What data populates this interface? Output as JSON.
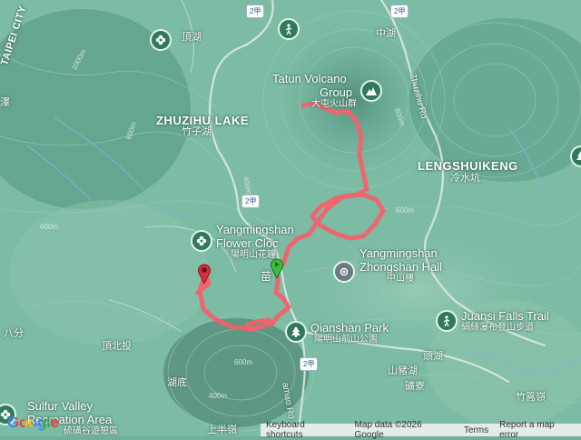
{
  "places": {
    "taipei_city": "TAIPEI CITY",
    "dinghu": "頂湖",
    "zhuzihu_en": "ZHUZIHU LAKE",
    "zhuzihu_zh": "竹子湖",
    "tatun_en_1": "Tatun Volcano",
    "tatun_en_2": "Group",
    "tatun_zh": "大屯火山群",
    "zhonghu": "中湖",
    "lengshuikeng_en": "LENGSHUIKENG",
    "lengshuikeng_zh": "冷水坑",
    "flower_clock_en_1": "Yangmingshan",
    "flower_clock_en_2": "Flower Cloc",
    "flower_clock_zh": "陽明山花鐘",
    "zhongshan_en_1": "Yangmingshan",
    "zhongshan_en_2": "Zhongshan Hall",
    "zhongshan_zh": "中山樓",
    "qianshan_en": "Qianshan Park",
    "qianshan_zh": "陽明山前山公園",
    "juansi_en": "Juansi Falls Trail",
    "juansi_zh": "絹絲瀑布登山步道",
    "toutu": "頭湖",
    "shanzhuhu": "山豬湖",
    "dingbeitou": "頂北投",
    "hudi": "湖底",
    "bafen": "八分",
    "sulfur_en_1": "Sulfur Valley",
    "sulfur_en_2": "Recreation Area",
    "sulfur_zh": "硫磺谷遊憩區",
    "zhuwei": "竹篙嶺",
    "kuangliao": "礦寮",
    "shangban": "上半嶺",
    "ze": "澤",
    "zhuzihu_rd": "Zhuzihu Rd",
    "yangjin_rd": "amao Rd",
    "yan": "苗"
  },
  "roads": {
    "shield_top": "2甲",
    "shield_mid": "2甲",
    "shield_bottom": "2甲",
    "shield_low_right": "2甲"
  },
  "contours": {
    "c1": "600m",
    "c2": "400m",
    "c3": "600m",
    "c4": "800m",
    "c5": "600m",
    "c6": "400m",
    "c7": "1000m",
    "c8": "600m"
  },
  "footer": {
    "logo": "Google",
    "keyboard": "Keyboard shortcuts",
    "mapdata": "Map data ©2026 Google",
    "terms": "Terms",
    "report": "Report a map error"
  },
  "colors": {
    "route": "#f2626b",
    "start_marker": "#3fbf3f",
    "end_marker": "#d6303a",
    "terrain": "#6fb09a"
  },
  "icons": {
    "mountain": "mountain-icon",
    "flower": "flower-icon",
    "hiker": "hiker-icon",
    "tree": "tree-icon",
    "landmark": "landmark-icon"
  }
}
